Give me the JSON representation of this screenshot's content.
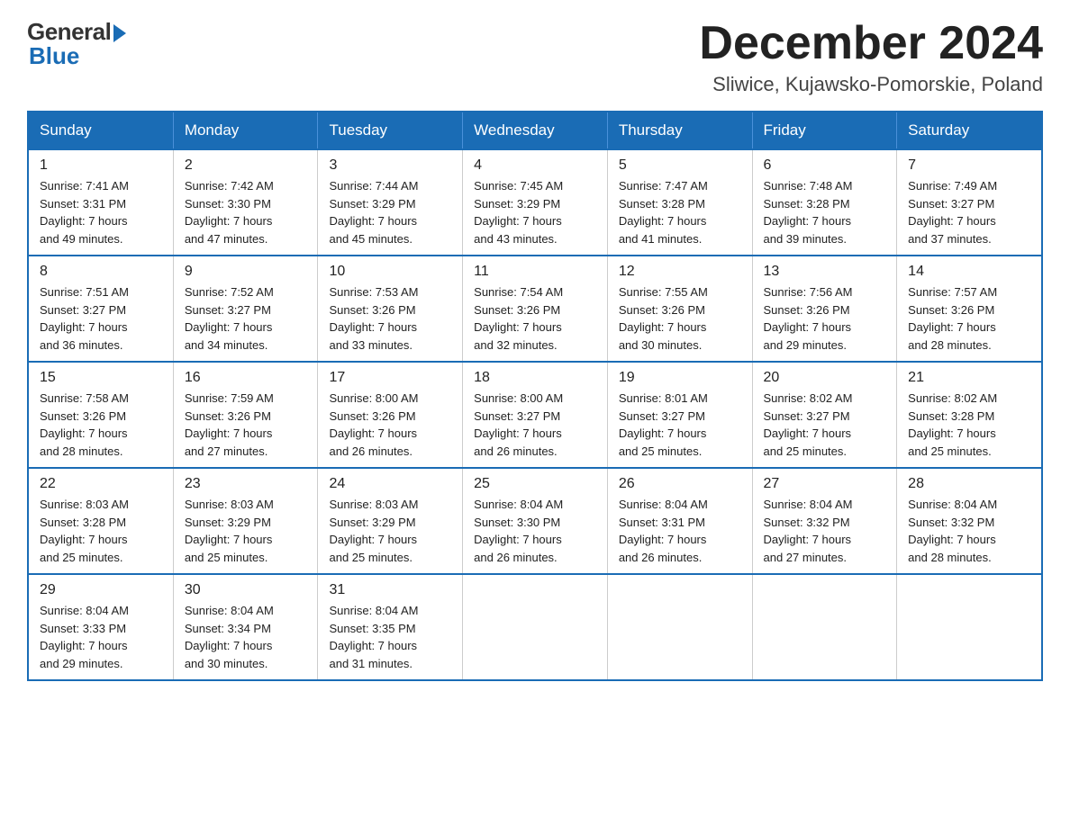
{
  "header": {
    "logo_general": "General",
    "logo_blue": "Blue",
    "month_title": "December 2024",
    "location": "Sliwice, Kujawsko-Pomorskie, Poland"
  },
  "days_of_week": [
    "Sunday",
    "Monday",
    "Tuesday",
    "Wednesday",
    "Thursday",
    "Friday",
    "Saturday"
  ],
  "weeks": [
    [
      {
        "day": "1",
        "sunrise": "7:41 AM",
        "sunset": "3:31 PM",
        "daylight": "7 hours and 49 minutes."
      },
      {
        "day": "2",
        "sunrise": "7:42 AM",
        "sunset": "3:30 PM",
        "daylight": "7 hours and 47 minutes."
      },
      {
        "day": "3",
        "sunrise": "7:44 AM",
        "sunset": "3:29 PM",
        "daylight": "7 hours and 45 minutes."
      },
      {
        "day": "4",
        "sunrise": "7:45 AM",
        "sunset": "3:29 PM",
        "daylight": "7 hours and 43 minutes."
      },
      {
        "day": "5",
        "sunrise": "7:47 AM",
        "sunset": "3:28 PM",
        "daylight": "7 hours and 41 minutes."
      },
      {
        "day": "6",
        "sunrise": "7:48 AM",
        "sunset": "3:28 PM",
        "daylight": "7 hours and 39 minutes."
      },
      {
        "day": "7",
        "sunrise": "7:49 AM",
        "sunset": "3:27 PM",
        "daylight": "7 hours and 37 minutes."
      }
    ],
    [
      {
        "day": "8",
        "sunrise": "7:51 AM",
        "sunset": "3:27 PM",
        "daylight": "7 hours and 36 minutes."
      },
      {
        "day": "9",
        "sunrise": "7:52 AM",
        "sunset": "3:27 PM",
        "daylight": "7 hours and 34 minutes."
      },
      {
        "day": "10",
        "sunrise": "7:53 AM",
        "sunset": "3:26 PM",
        "daylight": "7 hours and 33 minutes."
      },
      {
        "day": "11",
        "sunrise": "7:54 AM",
        "sunset": "3:26 PM",
        "daylight": "7 hours and 32 minutes."
      },
      {
        "day": "12",
        "sunrise": "7:55 AM",
        "sunset": "3:26 PM",
        "daylight": "7 hours and 30 minutes."
      },
      {
        "day": "13",
        "sunrise": "7:56 AM",
        "sunset": "3:26 PM",
        "daylight": "7 hours and 29 minutes."
      },
      {
        "day": "14",
        "sunrise": "7:57 AM",
        "sunset": "3:26 PM",
        "daylight": "7 hours and 28 minutes."
      }
    ],
    [
      {
        "day": "15",
        "sunrise": "7:58 AM",
        "sunset": "3:26 PM",
        "daylight": "7 hours and 28 minutes."
      },
      {
        "day": "16",
        "sunrise": "7:59 AM",
        "sunset": "3:26 PM",
        "daylight": "7 hours and 27 minutes."
      },
      {
        "day": "17",
        "sunrise": "8:00 AM",
        "sunset": "3:26 PM",
        "daylight": "7 hours and 26 minutes."
      },
      {
        "day": "18",
        "sunrise": "8:00 AM",
        "sunset": "3:27 PM",
        "daylight": "7 hours and 26 minutes."
      },
      {
        "day": "19",
        "sunrise": "8:01 AM",
        "sunset": "3:27 PM",
        "daylight": "7 hours and 25 minutes."
      },
      {
        "day": "20",
        "sunrise": "8:02 AM",
        "sunset": "3:27 PM",
        "daylight": "7 hours and 25 minutes."
      },
      {
        "day": "21",
        "sunrise": "8:02 AM",
        "sunset": "3:28 PM",
        "daylight": "7 hours and 25 minutes."
      }
    ],
    [
      {
        "day": "22",
        "sunrise": "8:03 AM",
        "sunset": "3:28 PM",
        "daylight": "7 hours and 25 minutes."
      },
      {
        "day": "23",
        "sunrise": "8:03 AM",
        "sunset": "3:29 PM",
        "daylight": "7 hours and 25 minutes."
      },
      {
        "day": "24",
        "sunrise": "8:03 AM",
        "sunset": "3:29 PM",
        "daylight": "7 hours and 25 minutes."
      },
      {
        "day": "25",
        "sunrise": "8:04 AM",
        "sunset": "3:30 PM",
        "daylight": "7 hours and 26 minutes."
      },
      {
        "day": "26",
        "sunrise": "8:04 AM",
        "sunset": "3:31 PM",
        "daylight": "7 hours and 26 minutes."
      },
      {
        "day": "27",
        "sunrise": "8:04 AM",
        "sunset": "3:32 PM",
        "daylight": "7 hours and 27 minutes."
      },
      {
        "day": "28",
        "sunrise": "8:04 AM",
        "sunset": "3:32 PM",
        "daylight": "7 hours and 28 minutes."
      }
    ],
    [
      {
        "day": "29",
        "sunrise": "8:04 AM",
        "sunset": "3:33 PM",
        "daylight": "7 hours and 29 minutes."
      },
      {
        "day": "30",
        "sunrise": "8:04 AM",
        "sunset": "3:34 PM",
        "daylight": "7 hours and 30 minutes."
      },
      {
        "day": "31",
        "sunrise": "8:04 AM",
        "sunset": "3:35 PM",
        "daylight": "7 hours and 31 minutes."
      },
      null,
      null,
      null,
      null
    ]
  ],
  "labels": {
    "sunrise": "Sunrise:",
    "sunset": "Sunset:",
    "daylight": "Daylight:"
  }
}
